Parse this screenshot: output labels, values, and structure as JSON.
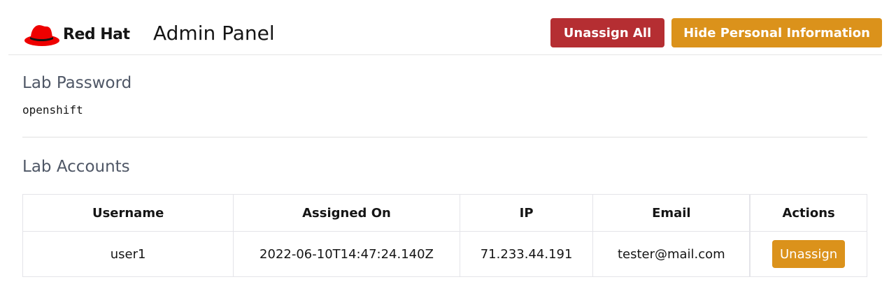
{
  "header": {
    "logo_text": "Red Hat",
    "title": "Admin Panel",
    "unassign_all_label": "Unassign All",
    "hide_info_label": "Hide Personal Information"
  },
  "colors": {
    "danger": "#b52e32",
    "warning": "#db921b",
    "brand_red": "#ee0000"
  },
  "password_section": {
    "title": "Lab Password",
    "value": "openshift"
  },
  "accounts_section": {
    "title": "Lab Accounts",
    "columns": [
      "Username",
      "Assigned On",
      "IP",
      "Email",
      "Actions"
    ],
    "rows": [
      {
        "username": "user1",
        "assigned_on": "2022-06-10T14:47:24.140Z",
        "ip": "71.233.44.191",
        "email": "tester@mail.com",
        "action_label": "Unassign"
      }
    ]
  }
}
